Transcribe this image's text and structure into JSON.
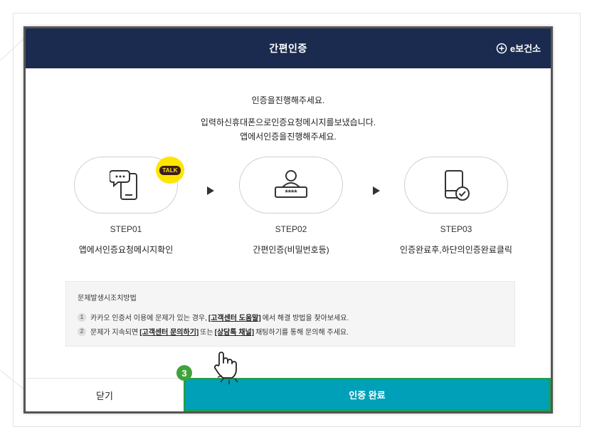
{
  "modal": {
    "title": "간편인증",
    "brand": "e보건소",
    "intro_heading": "인증을진행해주세요.",
    "intro_line1": "입력하신휴대폰으로인증요청메시지를보냈습니다.",
    "intro_line2": "앱에서인증을진행해주세요."
  },
  "steps": [
    {
      "label": "STEP01",
      "desc": "앱에서인증요청메시지확인",
      "icon": "phone-chat-icon",
      "badge": "TALK"
    },
    {
      "label": "STEP02",
      "desc": "간편인증(비밀번호등)",
      "icon": "user-password-icon",
      "password_mask": "****"
    },
    {
      "label": "STEP03",
      "desc": "인증완료후,하단의인증완료클릭",
      "icon": "phone-check-icon"
    }
  ],
  "help": {
    "title": "문제발생시조치방법",
    "items": [
      {
        "num": "1",
        "pre": "카카오 인증서 이용에 문제가 있는 경우,",
        "link": "[고객센터 도움말]",
        "post": "에서 해결 방법을 찾아보세요."
      },
      {
        "num": "2",
        "pre": "문제가 지속되면",
        "link": "[고객센터 문의하기]",
        "mid": "또는",
        "link2": "[상담톡 채널]",
        "post": "채팅하기를 통해 문의해 주세요."
      }
    ]
  },
  "buttons": {
    "close": "닫기",
    "confirm": "인증 완료"
  },
  "annotation": {
    "step_number": "3"
  },
  "colors": {
    "header_bg": "#1b2b4f",
    "confirm_bg": "#00a0b9",
    "highlight_border": "#1e9f4f",
    "talk_yellow": "#fee500",
    "badge_green": "#3fa33a"
  }
}
